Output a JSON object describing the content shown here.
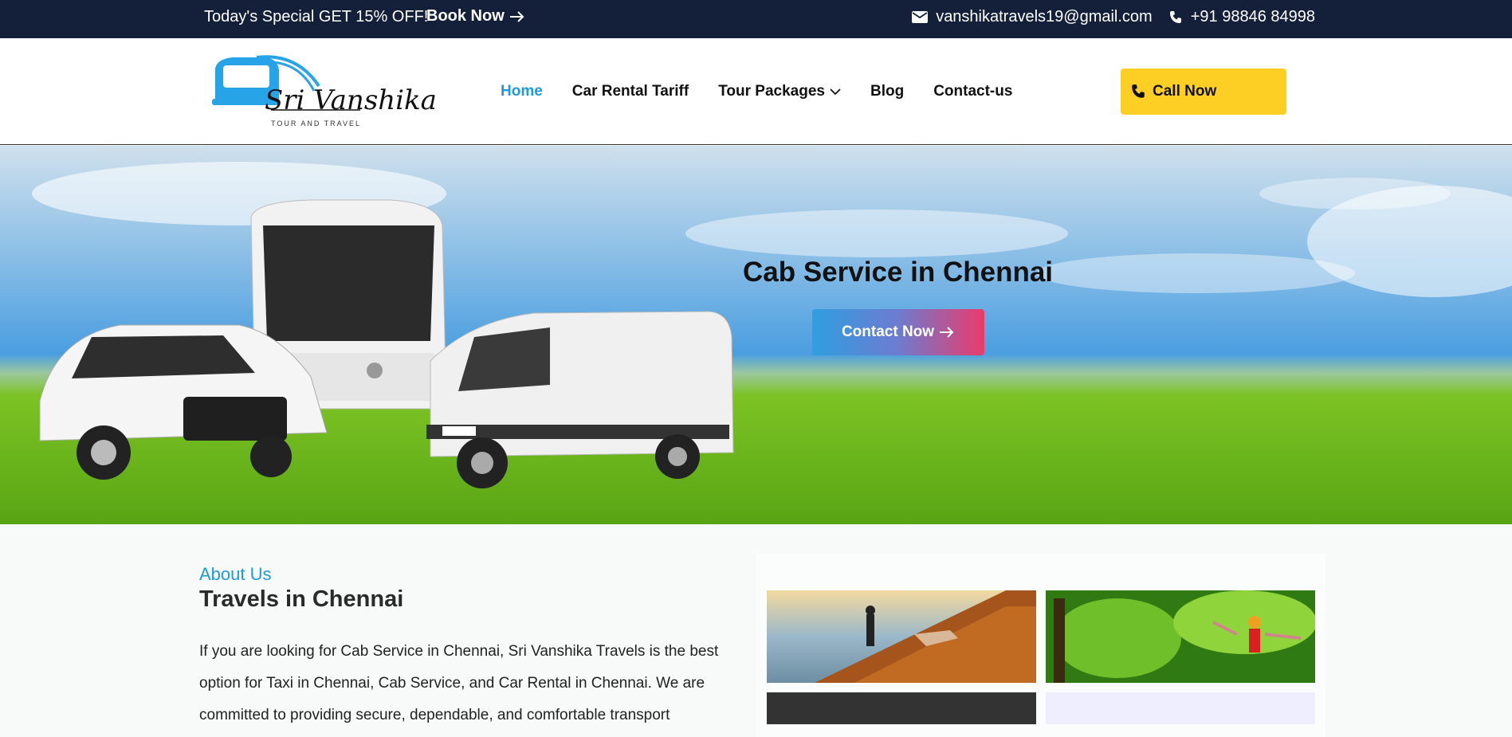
{
  "topbar": {
    "promo": "Today's Special GET 15% OFF!",
    "book_label": "Book Now",
    "email": "vanshikatravels19@gmail.com",
    "phone": "+91 98846 84998"
  },
  "logo": {
    "brand": "Sri Vanshika",
    "tagline": "TOUR AND TRAVEL"
  },
  "nav": {
    "items": [
      {
        "label": "Home"
      },
      {
        "label": "Car Rental Tariff"
      },
      {
        "label": "Tour Packages"
      },
      {
        "label": "Blog"
      },
      {
        "label": "Contact-us"
      }
    ],
    "call_label": "Call Now"
  },
  "hero": {
    "title": "Cab Service in Chennai",
    "cta_label": "Contact Now"
  },
  "about": {
    "eyebrow": "About Us",
    "title": "Travels in Chennai",
    "body": "If you are looking for Cab Service in Chennai, Sri Vanshika Travels is the best option for Taxi in Chennai, Cab Service, and Car Rental in Chennai. We are committed to providing secure, dependable, and comfortable transport"
  },
  "colors": {
    "topbar_bg": "#14203a",
    "accent_blue": "#1f9ad6",
    "call_yellow": "#fdcf24",
    "cta_start": "#2f9fe0",
    "cta_end": "#e93c6a"
  },
  "icons": [
    "arrow-right-icon",
    "envelope-icon",
    "phone-icon",
    "chevron-down-icon",
    "bus-logo-icon"
  ]
}
